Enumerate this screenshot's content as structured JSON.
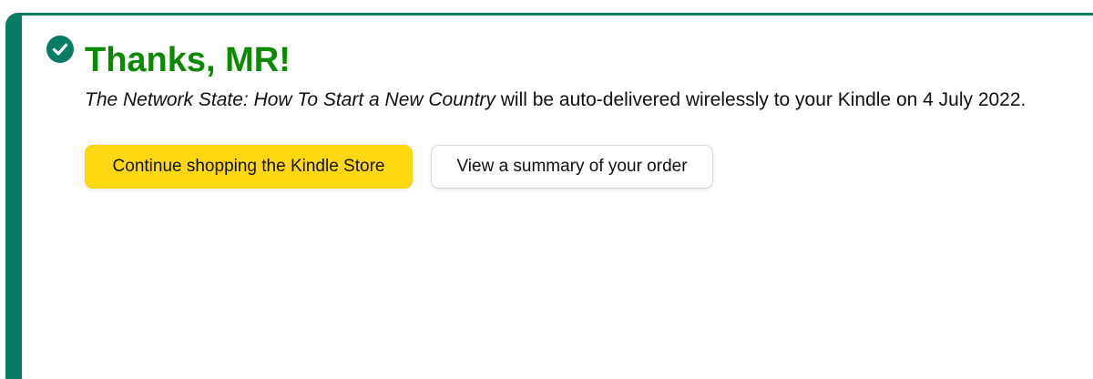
{
  "confirmation": {
    "heading": "Thanks, MR!",
    "book_title": "The Network State: How To Start a New Country",
    "delivery_message": " will be auto-delivered wirelessly to your Kindle on 4 July 2022.",
    "icon": "check-circle-icon"
  },
  "actions": {
    "continue_shopping_label": "Continue shopping the Kindle Store",
    "view_summary_label": "View a summary of your order"
  },
  "colors": {
    "accent": "#067d62",
    "heading": "#0a8a00",
    "primary_button": "#ffd814"
  }
}
